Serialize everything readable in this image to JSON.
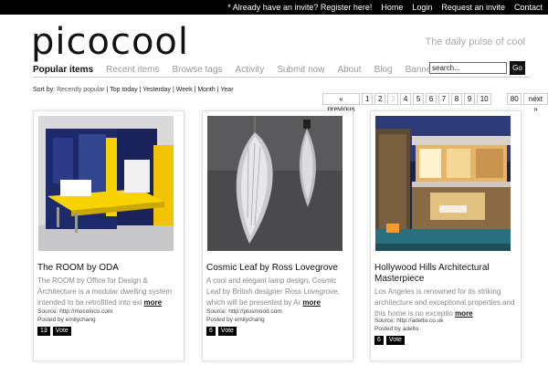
{
  "topbar": {
    "invite": "* Already have an invite? Register here!",
    "home": "Home",
    "login": "Login",
    "request": "Request an invite",
    "contact": "Contact"
  },
  "brand": {
    "logo": "picocool",
    "tagline": "The daily pulse of cool"
  },
  "nav": {
    "items": [
      "Popular items",
      "Recent items",
      "Browse tags",
      "Activity",
      "Submit now",
      "About",
      "Blog",
      "Banners"
    ]
  },
  "search": {
    "value": "search...",
    "button": "Go"
  },
  "sort": {
    "label": "Sort by:",
    "options": [
      "Recently popular",
      "Top today",
      "Yesterday",
      "Week",
      "Month",
      "Year"
    ]
  },
  "pagination": {
    "prev": "« previous",
    "pages": [
      "1",
      "2",
      "3",
      "4",
      "5",
      "6",
      "7",
      "8",
      "9",
      "10"
    ],
    "last": "80",
    "next": "next »",
    "current": "3"
  },
  "cards": [
    {
      "title": "The ROOM by ODA",
      "desc": "The ROOM by Office for Design & Architecture is a modular dwelling system intended to be retrofitted into exi",
      "more": "more",
      "source": "Source: http://mocoloco.com",
      "posted": "Posted by emilychang",
      "count": "13",
      "vote": "Vote"
    },
    {
      "title": "Cosmic Leaf by Ross Lovegrove",
      "desc": "A cool and elegant lamp design, Cosmic Leaf by British designer Ross Lovegrove, which will be presented by Ar",
      "more": "more",
      "source": "Source: http://plusmood.com",
      "posted": "Posted by emilychang",
      "count": "6",
      "vote": "Vote"
    },
    {
      "title": "Hollywood Hills Architectural Masterpiece",
      "desc": "Los Angeles is renowned for its striking architecture and exceptional properties and this home is no exceptio",
      "more": "more",
      "source": "Source: http://adelto.co.uk",
      "posted": "Posted by adelto",
      "count": "6",
      "vote": "Vote"
    }
  ]
}
